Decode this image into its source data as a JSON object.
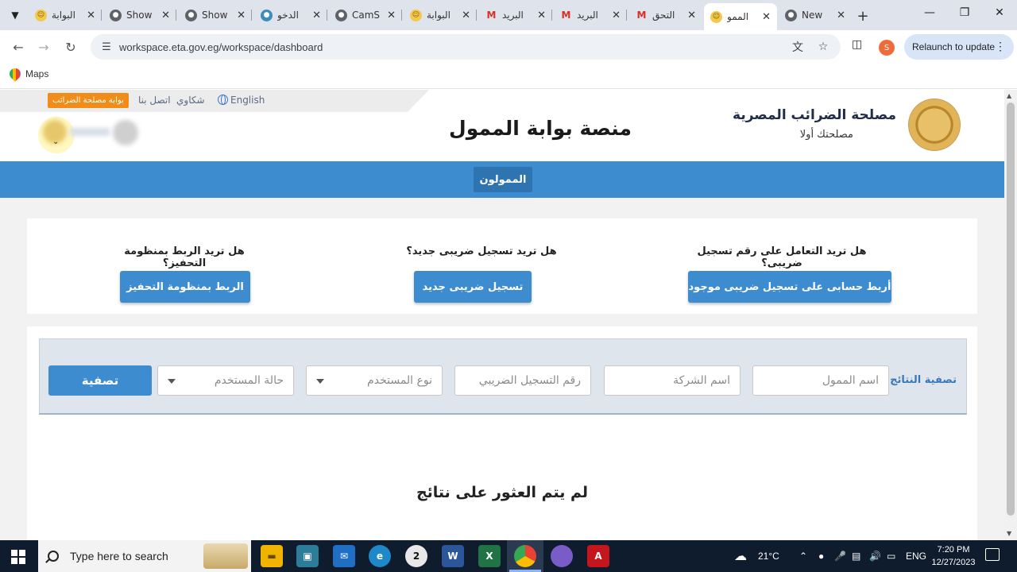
{
  "browser": {
    "tabs": [
      {
        "title": "البوابة",
        "icon": "smile-favicon"
      },
      {
        "title": "Show",
        "icon": "globe-favicon"
      },
      {
        "title": "Show",
        "icon": "globe-favicon"
      },
      {
        "title": "الدخو",
        "icon": "site-favicon"
      },
      {
        "title": "CamS",
        "icon": "globe-favicon"
      },
      {
        "title": "البوابة",
        "icon": "smile-favicon"
      },
      {
        "title": "البريد",
        "icon": "gmail-favicon"
      },
      {
        "title": "البريد",
        "icon": "gmail-favicon"
      },
      {
        "title": "التحق",
        "icon": "gmail-favicon"
      },
      {
        "title": "الممو",
        "icon": "smile-favicon",
        "active": true
      },
      {
        "title": "New",
        "icon": "globe-favicon"
      }
    ],
    "url": "workspace.eta.gov.eg/workspace/dashboard",
    "profile_initial": "S",
    "relaunch_label": "Relaunch to update",
    "bookmark_label": "Maps"
  },
  "header": {
    "portal_badge": "بوابة مصلحة الضرائب",
    "contact_link": "اتصل بنا",
    "complaints_link": "شكاوي",
    "language_link": "English",
    "page_title": "منصة بوابة الممول",
    "org_name": "مصلحة الضرائب المصرية",
    "org_slogan": "مصلحتك أولا"
  },
  "nav": {
    "taxpayers_label": "الممولون"
  },
  "actions": {
    "items": [
      {
        "question": "هل تريد التعامل على رقم تسجيل ضريبى؟",
        "button": "أربط حسابى على تسجيل ضريبى موجود"
      },
      {
        "question": "هل تريد تسجيل ضريبى جديد؟",
        "button": "تسجيل ضريبى جديد"
      },
      {
        "question": "هل تريد الربط بمنظومة التحفيز؟",
        "button": "الربط بمنظومة التحفيز"
      }
    ]
  },
  "filter": {
    "label": "تصفية النتائج",
    "taxpayer_name_placeholder": "اسم الممول",
    "company_name_placeholder": "اسم الشركة",
    "tax_reg_placeholder": "رقم التسجيل الضريبي",
    "user_type_placeholder": "نوع المستخدم",
    "user_status_placeholder": "حالة المستخدم",
    "submit_label": "تصفية"
  },
  "results": {
    "empty_message": "لم يتم العثور على نتائج"
  },
  "taskbar": {
    "search_placeholder": "Type here to search",
    "chrome_badge": "2",
    "temperature": "21°C",
    "language": "ENG",
    "time": "7:20 PM",
    "date": "12/27/2023"
  }
}
